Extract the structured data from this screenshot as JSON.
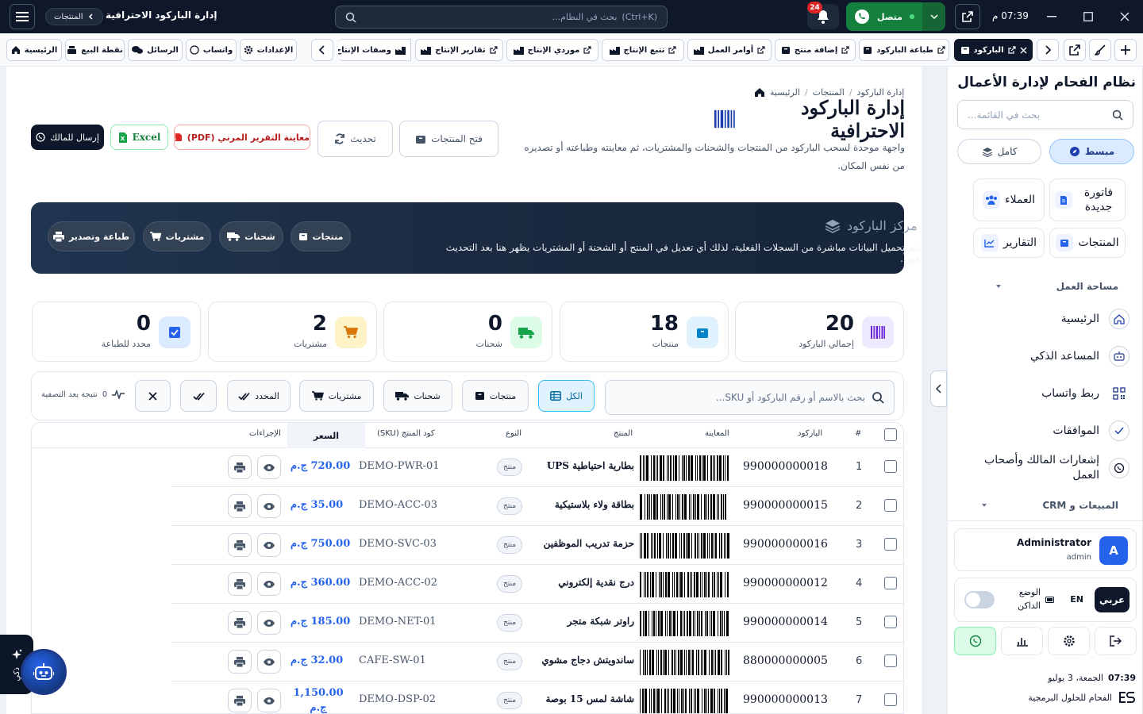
{
  "titlebar": {
    "crumb": "المنتجات",
    "title": "إدارة الباركود الاحترافية",
    "search_placeholder": "بحث في النظام...",
    "search_shortcut": "(Ctrl+K)",
    "notifications": "24",
    "whatsapp_status": "متصل",
    "time": "07:39 م"
  },
  "tabbar": {
    "tabs": [
      "الباركود",
      "طباعة الباركود",
      "إضافة منتج",
      "أوامر العمل",
      "تتبع الإنتاج",
      "موردي الإنتاج",
      "تقارير الإنتاج",
      "وصفات الإنتاج"
    ],
    "quick": [
      "الإعدادات",
      "واتساب",
      "الرسائل",
      "نقطة البيع",
      "الرئيسية"
    ]
  },
  "breadcrumb": [
    "الرئيسية",
    "المنتجات",
    "إدارة الباركود"
  ],
  "page": {
    "title": "إدارة الباركود الاحترافية",
    "description": "واجهة موحدة لسحب الباركود من المنتجات والشحنات والمشتريات، ثم معاينته وطباعته أو تصديره من نفس المكان."
  },
  "actions": {
    "open_products": "فتح المنتجات",
    "refresh": "تحديث",
    "pdf": "معاينة التقرير المرني (PDF)",
    "excel": "Excel",
    "send_owner": "إرسال للمالك"
  },
  "hero": {
    "title": "مركز الباركود",
    "description": "يتم تحميل البيانات مباشرة من السجلات الفعلية، لذلك أي تعديل في المنتج أو الشحنة أو المشتريات يظهر هنا بعد التحديث فوراً.",
    "pills": [
      "منتجات",
      "شحنات",
      "مشتريات",
      "طباعة وتصدير"
    ]
  },
  "stats": [
    {
      "value": "20",
      "label": "إجمالي الباركود",
      "color": "#6d28d9"
    },
    {
      "value": "18",
      "label": "منتجات",
      "color": "#0284c7"
    },
    {
      "value": "0",
      "label": "شحنات",
      "color": "#16a34a"
    },
    {
      "value": "2",
      "label": "مشتريات",
      "color": "#d97706"
    },
    {
      "value": "0",
      "label": "محدد للطباعة",
      "color": "#2563eb"
    }
  ],
  "filters": {
    "search_placeholder": "بحث بالاسم أو رقم الباركود أو SKU...",
    "all": "الكل",
    "products": "منتجات",
    "shipments": "شحنات",
    "purchases": "مشتريات",
    "selected": "المحدد",
    "result_count": "0",
    "result_text": "نتيجة بعد التصفية"
  },
  "table": {
    "headers": [
      "#",
      "الباركود",
      "المعاينة",
      "المنتج",
      "النوع",
      "كود المنتج (SKU)",
      "السعر",
      "الإجراءات"
    ],
    "rows": [
      {
        "n": "1",
        "barcode": "990000000018",
        "name": "بطارية احتياطية UPS",
        "type": "منتج",
        "sku": "DEMO-PWR-01",
        "price": "720.00 ج.م"
      },
      {
        "n": "2",
        "barcode": "990000000015",
        "name": "بطاقة ولاء بلاستيكية",
        "type": "منتج",
        "sku": "DEMO-ACC-03",
        "price": "35.00 ج.م"
      },
      {
        "n": "3",
        "barcode": "990000000016",
        "name": "حزمة تدريب الموظفين",
        "type": "منتج",
        "sku": "DEMO-SVC-03",
        "price": "750.00 ج.م"
      },
      {
        "n": "4",
        "barcode": "990000000012",
        "name": "درج نقدية إلكتروني",
        "type": "منتج",
        "sku": "DEMO-ACC-02",
        "price": "360.00 ج.م"
      },
      {
        "n": "5",
        "barcode": "990000000014",
        "name": "راوتر شبكة متجر",
        "type": "منتج",
        "sku": "DEMO-NET-01",
        "price": "185.00 ج.م"
      },
      {
        "n": "6",
        "barcode": "880000000005",
        "name": "ساندويتش دجاج مشوي",
        "type": "منتج",
        "sku": "CAFE-SW-01",
        "price": "32.00 ج.م"
      },
      {
        "n": "7",
        "barcode": "990000000013",
        "name": "شاشة لمس 15 بوصة",
        "type": "منتج",
        "sku": "DEMO-DSP-02",
        "price": "1,150.00 ج.م"
      }
    ]
  },
  "sidebar": {
    "title": "نظام الفحام لإدارة الأعمال",
    "search_placeholder": "بحث في القائمة...",
    "mode_simple": "مبسط",
    "mode_full": "كامل",
    "quick": [
      "فاتورة جديدة",
      "العملاء",
      "المنتجات",
      "التقارير"
    ],
    "section_workspace": "مساحة العمل",
    "nav": [
      "الرئيسية",
      "المساعد الذكي",
      "ربط واتساب",
      "الموافقات",
      "إشعارات المالك وأصحاب العمل"
    ],
    "section_sales": "المبيعات و CRM",
    "user_name": "Administrator",
    "user_role": "admin",
    "avatar": "A",
    "lang_ar": "عربي",
    "lang_en": "EN",
    "dark_mode": "الوضع الداكن",
    "time": "07:39",
    "date": "الجمعة، 3 يوليو",
    "company": "الفحام للحلول البرمجية"
  },
  "ai": {
    "label": "ذكي"
  }
}
